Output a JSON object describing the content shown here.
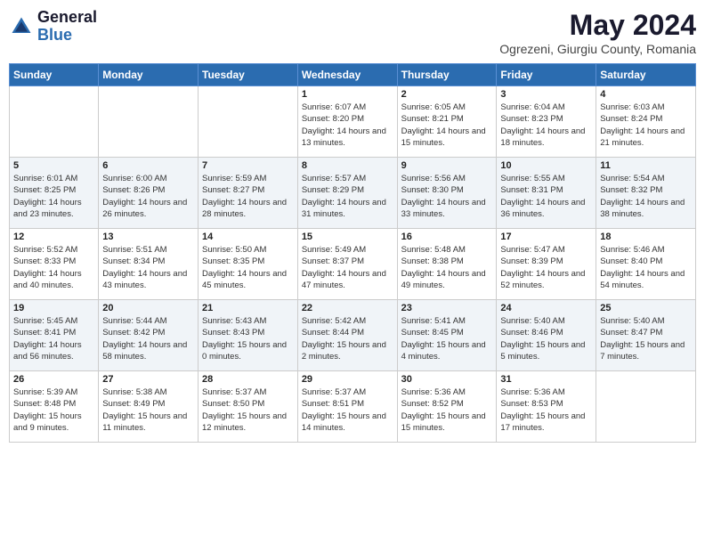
{
  "header": {
    "logo_general": "General",
    "logo_blue": "Blue",
    "month_year": "May 2024",
    "location": "Ogrezeni, Giurgiu County, Romania"
  },
  "weekdays": [
    "Sunday",
    "Monday",
    "Tuesday",
    "Wednesday",
    "Thursday",
    "Friday",
    "Saturday"
  ],
  "weeks": [
    [
      {
        "day": "",
        "detail": ""
      },
      {
        "day": "",
        "detail": ""
      },
      {
        "day": "",
        "detail": ""
      },
      {
        "day": "1",
        "detail": "Sunrise: 6:07 AM\nSunset: 8:20 PM\nDaylight: 14 hours and 13 minutes."
      },
      {
        "day": "2",
        "detail": "Sunrise: 6:05 AM\nSunset: 8:21 PM\nDaylight: 14 hours and 15 minutes."
      },
      {
        "day": "3",
        "detail": "Sunrise: 6:04 AM\nSunset: 8:23 PM\nDaylight: 14 hours and 18 minutes."
      },
      {
        "day": "4",
        "detail": "Sunrise: 6:03 AM\nSunset: 8:24 PM\nDaylight: 14 hours and 21 minutes."
      }
    ],
    [
      {
        "day": "5",
        "detail": "Sunrise: 6:01 AM\nSunset: 8:25 PM\nDaylight: 14 hours and 23 minutes."
      },
      {
        "day": "6",
        "detail": "Sunrise: 6:00 AM\nSunset: 8:26 PM\nDaylight: 14 hours and 26 minutes."
      },
      {
        "day": "7",
        "detail": "Sunrise: 5:59 AM\nSunset: 8:27 PM\nDaylight: 14 hours and 28 minutes."
      },
      {
        "day": "8",
        "detail": "Sunrise: 5:57 AM\nSunset: 8:29 PM\nDaylight: 14 hours and 31 minutes."
      },
      {
        "day": "9",
        "detail": "Sunrise: 5:56 AM\nSunset: 8:30 PM\nDaylight: 14 hours and 33 minutes."
      },
      {
        "day": "10",
        "detail": "Sunrise: 5:55 AM\nSunset: 8:31 PM\nDaylight: 14 hours and 36 minutes."
      },
      {
        "day": "11",
        "detail": "Sunrise: 5:54 AM\nSunset: 8:32 PM\nDaylight: 14 hours and 38 minutes."
      }
    ],
    [
      {
        "day": "12",
        "detail": "Sunrise: 5:52 AM\nSunset: 8:33 PM\nDaylight: 14 hours and 40 minutes."
      },
      {
        "day": "13",
        "detail": "Sunrise: 5:51 AM\nSunset: 8:34 PM\nDaylight: 14 hours and 43 minutes."
      },
      {
        "day": "14",
        "detail": "Sunrise: 5:50 AM\nSunset: 8:35 PM\nDaylight: 14 hours and 45 minutes."
      },
      {
        "day": "15",
        "detail": "Sunrise: 5:49 AM\nSunset: 8:37 PM\nDaylight: 14 hours and 47 minutes."
      },
      {
        "day": "16",
        "detail": "Sunrise: 5:48 AM\nSunset: 8:38 PM\nDaylight: 14 hours and 49 minutes."
      },
      {
        "day": "17",
        "detail": "Sunrise: 5:47 AM\nSunset: 8:39 PM\nDaylight: 14 hours and 52 minutes."
      },
      {
        "day": "18",
        "detail": "Sunrise: 5:46 AM\nSunset: 8:40 PM\nDaylight: 14 hours and 54 minutes."
      }
    ],
    [
      {
        "day": "19",
        "detail": "Sunrise: 5:45 AM\nSunset: 8:41 PM\nDaylight: 14 hours and 56 minutes."
      },
      {
        "day": "20",
        "detail": "Sunrise: 5:44 AM\nSunset: 8:42 PM\nDaylight: 14 hours and 58 minutes."
      },
      {
        "day": "21",
        "detail": "Sunrise: 5:43 AM\nSunset: 8:43 PM\nDaylight: 15 hours and 0 minutes."
      },
      {
        "day": "22",
        "detail": "Sunrise: 5:42 AM\nSunset: 8:44 PM\nDaylight: 15 hours and 2 minutes."
      },
      {
        "day": "23",
        "detail": "Sunrise: 5:41 AM\nSunset: 8:45 PM\nDaylight: 15 hours and 4 minutes."
      },
      {
        "day": "24",
        "detail": "Sunrise: 5:40 AM\nSunset: 8:46 PM\nDaylight: 15 hours and 5 minutes."
      },
      {
        "day": "25",
        "detail": "Sunrise: 5:40 AM\nSunset: 8:47 PM\nDaylight: 15 hours and 7 minutes."
      }
    ],
    [
      {
        "day": "26",
        "detail": "Sunrise: 5:39 AM\nSunset: 8:48 PM\nDaylight: 15 hours and 9 minutes."
      },
      {
        "day": "27",
        "detail": "Sunrise: 5:38 AM\nSunset: 8:49 PM\nDaylight: 15 hours and 11 minutes."
      },
      {
        "day": "28",
        "detail": "Sunrise: 5:37 AM\nSunset: 8:50 PM\nDaylight: 15 hours and 12 minutes."
      },
      {
        "day": "29",
        "detail": "Sunrise: 5:37 AM\nSunset: 8:51 PM\nDaylight: 15 hours and 14 minutes."
      },
      {
        "day": "30",
        "detail": "Sunrise: 5:36 AM\nSunset: 8:52 PM\nDaylight: 15 hours and 15 minutes."
      },
      {
        "day": "31",
        "detail": "Sunrise: 5:36 AM\nSunset: 8:53 PM\nDaylight: 15 hours and 17 minutes."
      },
      {
        "day": "",
        "detail": ""
      }
    ]
  ]
}
